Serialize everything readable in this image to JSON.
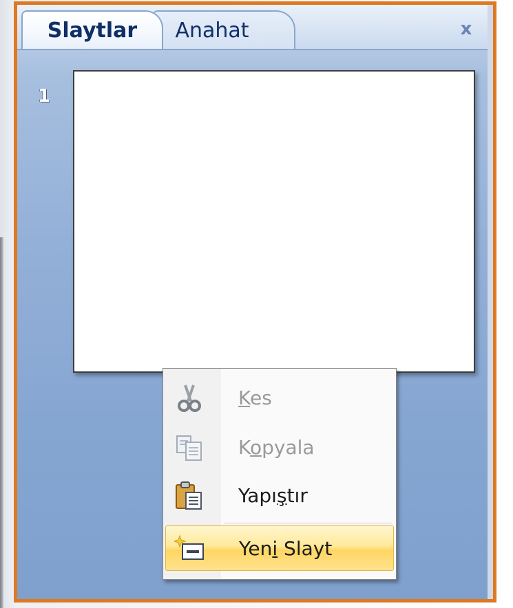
{
  "pane": {
    "tabs": [
      {
        "label": "Slaytlar",
        "active": true
      },
      {
        "label": "Anahat",
        "active": false
      }
    ],
    "close_label": "x",
    "slide_number": "1"
  },
  "context_menu": {
    "items": [
      {
        "pre": "",
        "ul": "K",
        "post": "es",
        "icon": "scissors-icon",
        "enabled": false,
        "highlighted": false
      },
      {
        "pre": "K",
        "ul": "o",
        "post": "pyala",
        "icon": "copy-icon",
        "enabled": false,
        "highlighted": false
      },
      {
        "pre": "Yapı",
        "ul": "ş",
        "post": "tır",
        "icon": "paste-icon",
        "enabled": true,
        "highlighted": false
      },
      {
        "pre": "Yen",
        "ul": "i",
        "post": " Slayt",
        "icon": "new-slide-icon",
        "enabled": true,
        "highlighted": true
      }
    ]
  },
  "colors": {
    "highlight_border": "#e07820",
    "pane_blue": "#86a6d2",
    "menu_hover": "#ffd664"
  }
}
